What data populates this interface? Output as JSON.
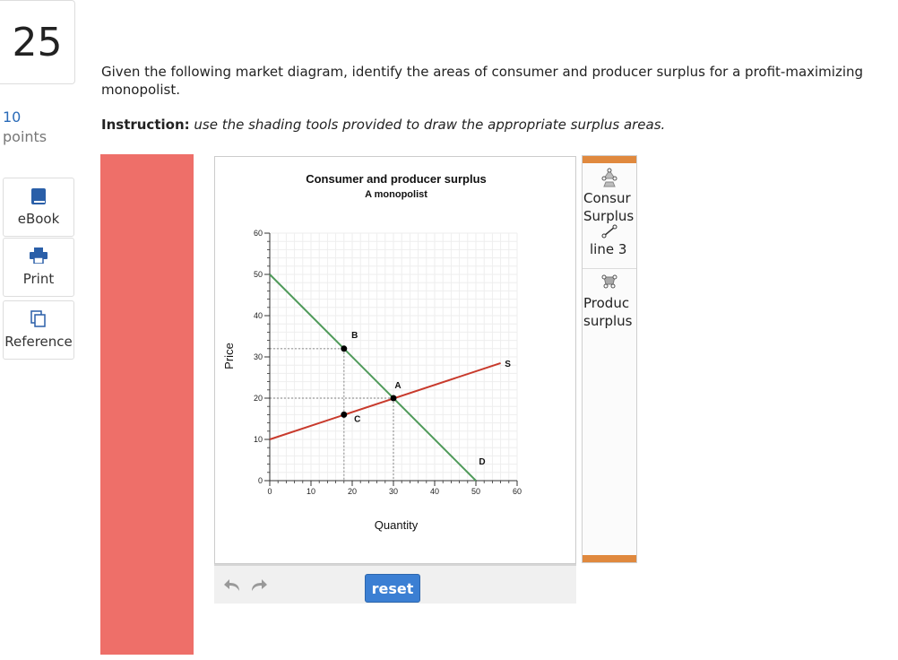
{
  "question": {
    "number": "25",
    "points_value": "10",
    "points_label": "points",
    "text": "Given the following market diagram, identify the areas of consumer and producer surplus for a profit-maximizing monopolist.",
    "instruction_label": "Instruction:",
    "instruction_text": "use the shading tools provided to draw the appropriate surplus areas."
  },
  "sidebar": {
    "items": [
      {
        "label": "eBook",
        "icon": "book-icon"
      },
      {
        "label": "Print",
        "icon": "printer-icon"
      },
      {
        "label": "Reference",
        "icon": "documents-icon"
      }
    ]
  },
  "palette": {
    "items": [
      {
        "label_lines": [
          "Consur",
          "Surplus"
        ],
        "icon": "polygon-tool-icon"
      },
      {
        "label_lines": [
          "line 3"
        ],
        "icon": "line-tool-icon"
      },
      {
        "label_lines": [
          "Produc",
          "surplus"
        ],
        "icon": "polygon-tool-icon"
      }
    ]
  },
  "toolbar": {
    "reset_label": "reset",
    "undo_icon": "undo-icon",
    "redo_icon": "redo-icon"
  },
  "colors": {
    "red_strip": "#ee6f69",
    "demand_line": "#4f9a5a",
    "supply_line": "#c83a2c",
    "reset_button": "#3b7fd3",
    "palette_accent": "#e0893e"
  },
  "chart_data": {
    "type": "line",
    "title": "Consumer and producer surplus",
    "subtitle": "A monopolist",
    "xlabel": "Quantity",
    "ylabel": "Price",
    "xlim": [
      0,
      60
    ],
    "ylim": [
      0,
      60
    ],
    "xticks": [
      0,
      10,
      20,
      30,
      40,
      50,
      60
    ],
    "yticks": [
      0,
      10,
      20,
      30,
      40,
      50,
      60
    ],
    "grid": true,
    "series": [
      {
        "name": "D",
        "points": [
          [
            0,
            50
          ],
          [
            50,
            0
          ]
        ]
      },
      {
        "name": "S",
        "points": [
          [
            0,
            10
          ],
          [
            56,
            28.5
          ]
        ]
      }
    ],
    "labeled_points": [
      {
        "label": "B",
        "x": 18,
        "y": 32
      },
      {
        "label": "A",
        "x": 30,
        "y": 20
      },
      {
        "label": "C",
        "x": 18,
        "y": 16
      }
    ],
    "guide_lines": [
      {
        "from": [
          0,
          32
        ],
        "to": [
          18,
          32
        ]
      },
      {
        "from": [
          0,
          20
        ],
        "to": [
          30,
          20
        ]
      },
      {
        "from": [
          18,
          32
        ],
        "to": [
          18,
          0
        ]
      },
      {
        "from": [
          30,
          20
        ],
        "to": [
          30,
          0
        ]
      }
    ]
  }
}
